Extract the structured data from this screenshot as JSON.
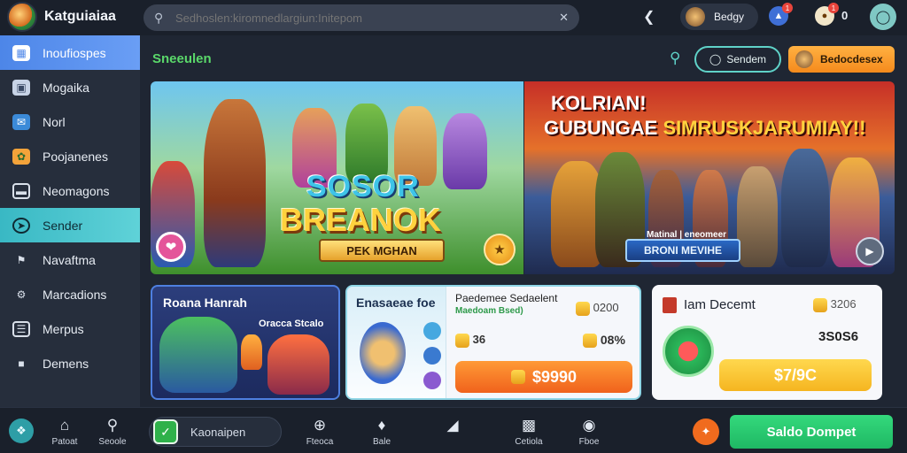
{
  "app": {
    "title": "Katguiaiaa"
  },
  "search": {
    "placeholder": "Sedhoslen:kiromnedlargiun:Initepom"
  },
  "header": {
    "player_name": "Bedgy",
    "coin_count": "0",
    "notif_badge_1": "1",
    "notif_badge_2": "1"
  },
  "sidebar": {
    "items": [
      {
        "label": "Inoufiospes",
        "icon": "grid-icon",
        "state": "active"
      },
      {
        "label": "Mogaika",
        "icon": "image-icon"
      },
      {
        "label": "Norl",
        "icon": "chat-icon"
      },
      {
        "label": "Poojanenes",
        "icon": "palette-icon"
      },
      {
        "label": "Neomagons",
        "icon": "card-icon"
      },
      {
        "label": "Sender",
        "icon": "send-icon",
        "state": "highlight"
      },
      {
        "label": "Navaftma",
        "icon": "flag-icon"
      },
      {
        "label": "Marcadions",
        "icon": "settings-icon"
      },
      {
        "label": "Merpus",
        "icon": "list-icon"
      },
      {
        "label": "Demens",
        "icon": "message-icon"
      }
    ]
  },
  "main": {
    "section_title": "Sneeulen",
    "filter_button": "Sendem",
    "account_button": "Bedocdesex"
  },
  "banner_left": {
    "logo_line1": "SOSOR",
    "logo_line2": "BREANOK",
    "ribbon": "PEK MGHAN"
  },
  "banner_right": {
    "title_line1": "KOLRIAN!",
    "title_line2_a": "GUBUNGAE",
    "title_line2_b": "SIMRUSKJARUMIAY!!",
    "subtitle": "Matinal | eneomeer",
    "ribbon": "BRONI MEVIHE"
  },
  "cards": {
    "card1": {
      "title": "Roana Hanrah",
      "subtitle": "Oracca Stcalo"
    },
    "card2": {
      "title": "Enasaeae foe",
      "heading": "Paedemee Sedaelent",
      "green_text": "Maedoam Bsed)",
      "stat_left": "36",
      "stat_right_1": "0200",
      "stat_right_2": "08%",
      "price": "$9990"
    },
    "card3": {
      "title": "Iam Decemt",
      "stat_1": "3206",
      "stat_2": "3S0S6",
      "price": "$7/9C"
    }
  },
  "bottombar": {
    "nav": [
      {
        "label": "Patoat",
        "icon": "home-icon"
      },
      {
        "label": "Seoole",
        "icon": "search-icon"
      },
      {
        "label": "Fteoca",
        "icon": "compass-icon"
      },
      {
        "label": "Bale",
        "icon": "tag-icon"
      },
      {
        "label": "",
        "icon": "bookmark-icon"
      },
      {
        "label": "Cetiola",
        "icon": "gift-icon"
      },
      {
        "label": "Fboe",
        "icon": "pin-icon"
      }
    ],
    "field_label": "Kaonaipen",
    "cta_label": "Saldo Dompet"
  },
  "colors": {
    "accent_green": "#5ad86a",
    "accent_teal": "#5fd2c8",
    "accent_orange": "#f58a1c",
    "cta_green": "#1fb864"
  }
}
